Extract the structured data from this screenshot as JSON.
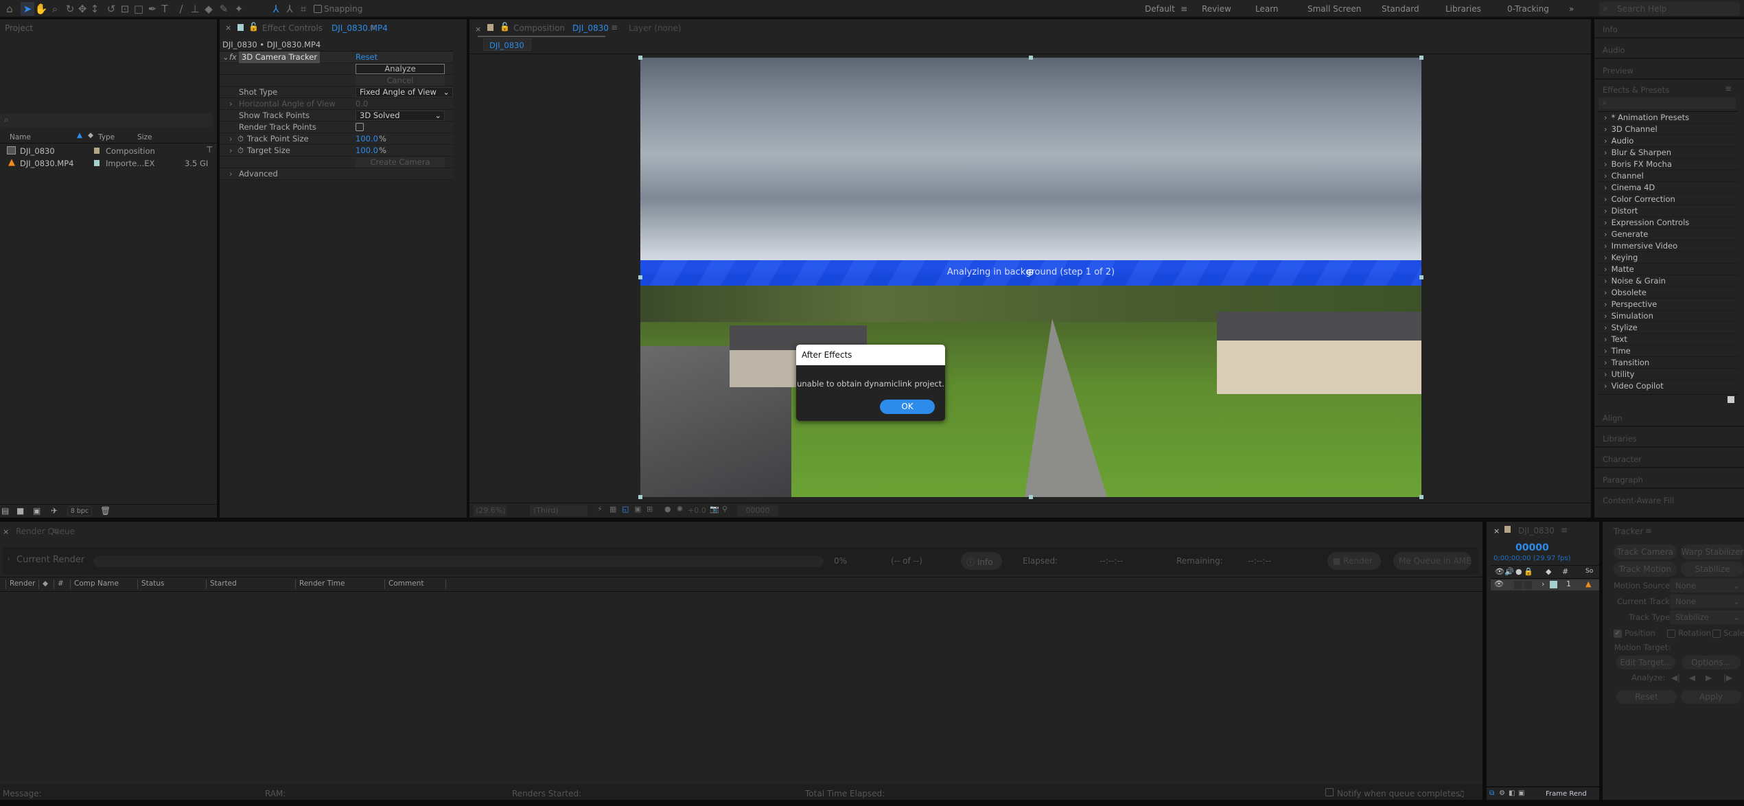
{
  "toolbar": {
    "snapping": "Snapping",
    "workspaces": [
      "Default",
      "Review",
      "Learn",
      "Small Screen",
      "Standard",
      "Libraries",
      "0-Tracking"
    ],
    "search_placeholder": "Search Help"
  },
  "project": {
    "title": "Project",
    "columns": [
      "Name",
      "Type",
      "Size"
    ],
    "items": [
      {
        "name": "DJI_0830",
        "type": "Composition",
        "size": "",
        "label_color": "#b5a488"
      },
      {
        "name": "DJI_0830.MP4",
        "type": "Importe...EX",
        "size": "3.5 GI",
        "label_color": "#a6cfcf"
      }
    ],
    "bpc": "8 bpc"
  },
  "effect_controls": {
    "tab_prefix": "Effect Controls",
    "tab_name": "DJI_0830.MP4",
    "breadcrumb": "DJI_0830 • DJI_0830.MP4",
    "effect": "3D Camera Tracker",
    "reset": "Reset",
    "analyze": "Analyze",
    "cancel": "Cancel",
    "shot_type_label": "Shot Type",
    "shot_type": "Fixed Angle of View",
    "hav_label": "Horizontal Angle of View",
    "hav": "0.0",
    "show_tp_label": "Show Track Points",
    "show_tp": "3D Solved",
    "render_tp_label": "Render Track Points",
    "tps_label": "Track Point Size",
    "tps": "100.0",
    "tps_unit": "%",
    "ts_label": "Target Size",
    "ts": "100.0",
    "ts_unit": "%",
    "create_camera": "Create Camera",
    "advanced": "Advanced"
  },
  "composition": {
    "tab_prefix": "Composition",
    "tab_name": "DJI_0830",
    "layer_tab": "Layer (none)",
    "sub_tab": "DJI_0830",
    "analyzing": "Analyzing in background (step 1 of 2)",
    "zoom": "(29.6%)",
    "resolution": "(Third)",
    "exposure": "+0.0",
    "timecode": "00000"
  },
  "dialog": {
    "title": "After Effects",
    "message": "unable to obtain dynamiclink project.",
    "ok": "OK"
  },
  "right_panels": {
    "top": [
      "Info",
      "Audio",
      "Preview"
    ],
    "effects_title": "Effects & Presets",
    "effects": [
      "* Animation Presets",
      "3D Channel",
      "Audio",
      "Blur & Sharpen",
      "Boris FX Mocha",
      "Channel",
      "Cinema 4D",
      "Color Correction",
      "Distort",
      "Expression Controls",
      "Generate",
      "Immersive Video",
      "Keying",
      "Matte",
      "Noise & Grain",
      "Obsolete",
      "Perspective",
      "Simulation",
      "Stylize",
      "Text",
      "Time",
      "Transition",
      "Utility",
      "Video Copilot"
    ],
    "bottom": [
      "Align",
      "Libraries",
      "Character",
      "Paragraph",
      "Content-Aware Fill"
    ]
  },
  "render_queue": {
    "title": "Render Queue",
    "current_render": "Current Render",
    "percent": "0%",
    "of": "(-- of --)",
    "info": "Info",
    "elapsed_label": "Elapsed:",
    "elapsed": "--:--:--",
    "remaining_label": "Remaining:",
    "remaining": "--:--:--",
    "render": "Render",
    "queue_ame": "Queue in AME",
    "columns": [
      "Render",
      "#",
      "Comp Name",
      "Status",
      "Started",
      "Render Time",
      "Comment"
    ]
  },
  "status_bar": {
    "message": "Message:",
    "ram": "RAM:",
    "renders_started": "Renders Started:",
    "total_time": "Total Time Elapsed:",
    "notify": "Notify when queue completes",
    "frame_render": "Frame Rend"
  },
  "timeline": {
    "title": "DJI_0830",
    "timecode": "00000",
    "timecode_sub": "0;00;00;00 (29.97 fps)",
    "layer_num": "1",
    "source_col": "So"
  },
  "tracker": {
    "title": "Tracker",
    "track_camera": "Track Camera",
    "warp_stabilizer": "Warp Stabilizer",
    "track_motion": "Track Motion",
    "stabilize_motion": "Stabilize Motion",
    "motion_source_label": "Motion Source:",
    "motion_source": "None",
    "current_track_label": "Current Track:",
    "current_track": "None",
    "track_type_label": "Track Type:",
    "track_type": "Stabilize",
    "position": "Position",
    "rotation": "Rotation",
    "scale": "Scale",
    "position_checked": true,
    "motion_target": "Motion Target:",
    "edit_target": "Edit Target...",
    "options": "Options...",
    "analyze": "Analyze:",
    "reset": "Reset",
    "apply": "Apply"
  },
  "colors": {
    "accent": "#2d8ceb",
    "analyzing_bar": "#1447e6",
    "ok_button": "#2d8ceb"
  }
}
